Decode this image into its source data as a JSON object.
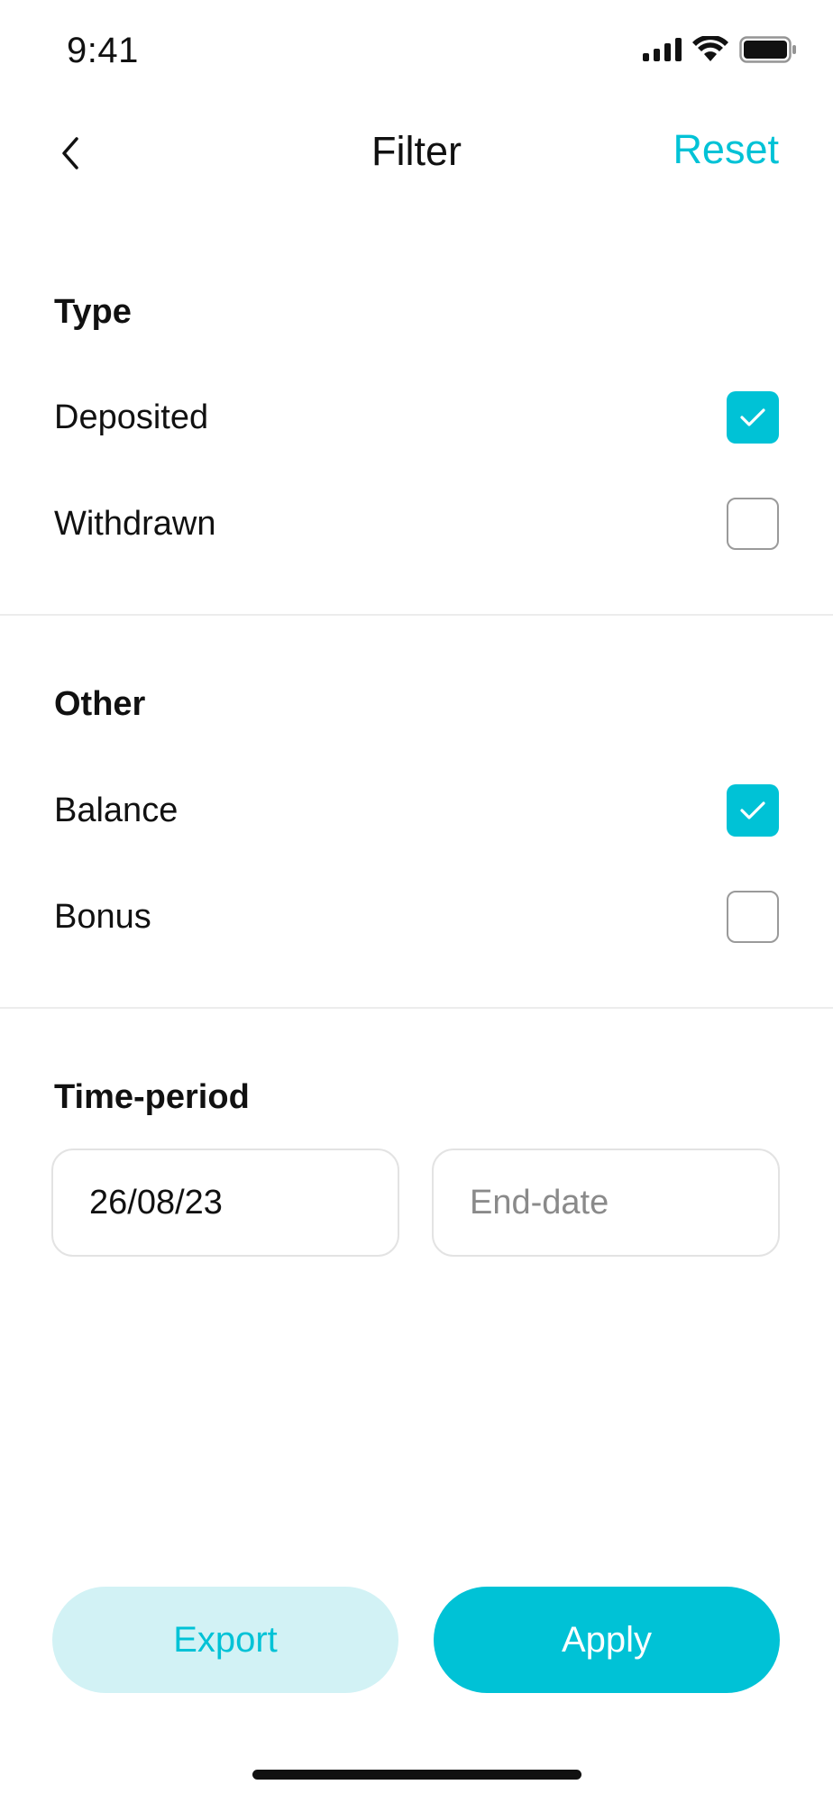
{
  "theme": {
    "accent": "#00C2D6"
  },
  "status_bar": {
    "time": "9:41"
  },
  "nav": {
    "title": "Filter",
    "reset_label": "Reset",
    "back_icon": "chevron-left-icon"
  },
  "type_section": {
    "title": "Type",
    "options": [
      {
        "label": "Deposited",
        "checked": true
      },
      {
        "label": "Withdrawn",
        "checked": false
      }
    ]
  },
  "other_section": {
    "title": "Other",
    "options": [
      {
        "label": "Balance",
        "checked": true
      },
      {
        "label": "Bonus",
        "checked": false
      }
    ]
  },
  "time_period": {
    "title": "Time-period",
    "start_date": {
      "value": "26/08/23"
    },
    "end_date": {
      "value": "",
      "placeholder": "End-date"
    }
  },
  "actions": {
    "export_label": "Export",
    "apply_label": "Apply"
  }
}
